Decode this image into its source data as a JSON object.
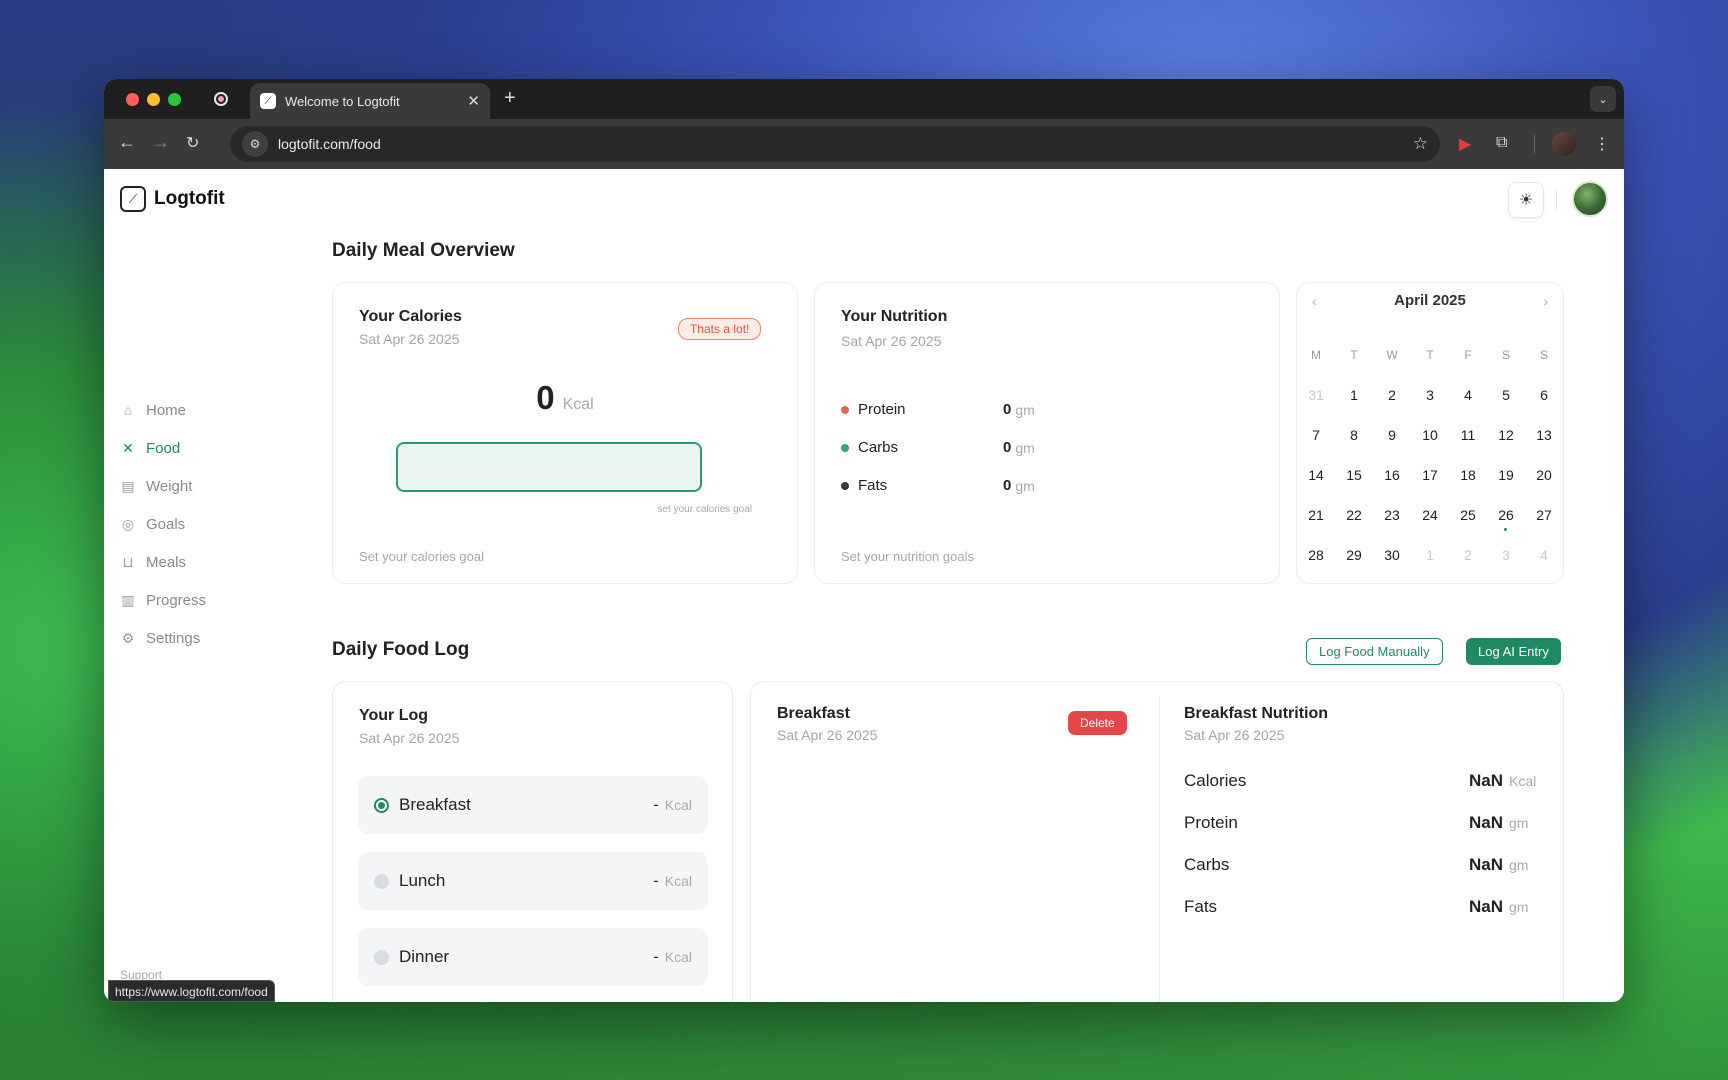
{
  "browser": {
    "tab_title": "Welcome to Logtofit",
    "url": "logtofit.com/food",
    "status_url": "https://www.logtofit.com/food"
  },
  "app": {
    "name": "Logtofit"
  },
  "sidebar": {
    "items": [
      {
        "label": "Home",
        "icon": "home-icon"
      },
      {
        "label": "Food",
        "icon": "utensils-icon",
        "active": true
      },
      {
        "label": "Weight",
        "icon": "scale-icon"
      },
      {
        "label": "Goals",
        "icon": "target-icon"
      },
      {
        "label": "Meals",
        "icon": "bowl-icon"
      },
      {
        "label": "Progress",
        "icon": "bar-chart-icon"
      },
      {
        "label": "Settings",
        "icon": "gear-icon"
      }
    ],
    "support_label": "Support"
  },
  "overview": {
    "title": "Daily Meal Overview",
    "calories": {
      "title": "Your Calories",
      "date": "Sat Apr 26 2025",
      "badge": "Thats a lot!",
      "value": "0",
      "unit": "Kcal",
      "input_hint": "set your calories goal",
      "footer": "Set your calories goal"
    },
    "nutrition": {
      "title": "Your Nutrition",
      "date": "Sat Apr 26 2025",
      "items": [
        {
          "name": "Protein",
          "value": "0",
          "unit": "gm",
          "color": "#e06a4f"
        },
        {
          "name": "Carbs",
          "value": "0",
          "unit": "gm",
          "color": "#2ea486"
        },
        {
          "name": "Fats",
          "value": "0",
          "unit": "gm",
          "color": "#2f3a44"
        }
      ],
      "footer": "Set your nutrition goals"
    },
    "calendar": {
      "month": "April 2025",
      "weekdays": [
        "M",
        "T",
        "W",
        "T",
        "F",
        "S",
        "S"
      ],
      "days": [
        {
          "d": "31",
          "muted": true
        },
        {
          "d": "1"
        },
        {
          "d": "2"
        },
        {
          "d": "3"
        },
        {
          "d": "4"
        },
        {
          "d": "5"
        },
        {
          "d": "6"
        },
        {
          "d": "7"
        },
        {
          "d": "8"
        },
        {
          "d": "9"
        },
        {
          "d": "10"
        },
        {
          "d": "11"
        },
        {
          "d": "12"
        },
        {
          "d": "13"
        },
        {
          "d": "14"
        },
        {
          "d": "15"
        },
        {
          "d": "16"
        },
        {
          "d": "17"
        },
        {
          "d": "18"
        },
        {
          "d": "19"
        },
        {
          "d": "20"
        },
        {
          "d": "21"
        },
        {
          "d": "22"
        },
        {
          "d": "23"
        },
        {
          "d": "24"
        },
        {
          "d": "25"
        },
        {
          "d": "26",
          "today": true
        },
        {
          "d": "27"
        },
        {
          "d": "28"
        },
        {
          "d": "29"
        },
        {
          "d": "30"
        },
        {
          "d": "1",
          "muted": true
        },
        {
          "d": "2",
          "muted": true
        },
        {
          "d": "3",
          "muted": true
        },
        {
          "d": "4",
          "muted": true
        }
      ]
    }
  },
  "food_log": {
    "title": "Daily Food Log",
    "btn_manual": "Log Food Manually",
    "btn_ai": "Log AI Entry",
    "your_log": {
      "title": "Your Log",
      "date": "Sat Apr 26 2025",
      "meals": [
        {
          "name": "Breakfast",
          "value": "-",
          "unit": "Kcal",
          "selected": true
        },
        {
          "name": "Lunch",
          "value": "-",
          "unit": "Kcal"
        },
        {
          "name": "Dinner",
          "value": "-",
          "unit": "Kcal"
        }
      ]
    },
    "meal_detail": {
      "title": "Breakfast",
      "date": "Sat Apr 26 2025",
      "delete_label": "Delete"
    },
    "meal_nutrition": {
      "title": "Breakfast Nutrition",
      "date": "Sat Apr 26 2025",
      "rows": [
        {
          "name": "Calories",
          "value": "NaN",
          "unit": "Kcal"
        },
        {
          "name": "Protein",
          "value": "NaN",
          "unit": "gm"
        },
        {
          "name": "Carbs",
          "value": "NaN",
          "unit": "gm"
        },
        {
          "name": "Fats",
          "value": "NaN",
          "unit": "gm"
        }
      ]
    }
  },
  "colors": {
    "accent": "#1f8a62",
    "danger": "#e34848"
  }
}
